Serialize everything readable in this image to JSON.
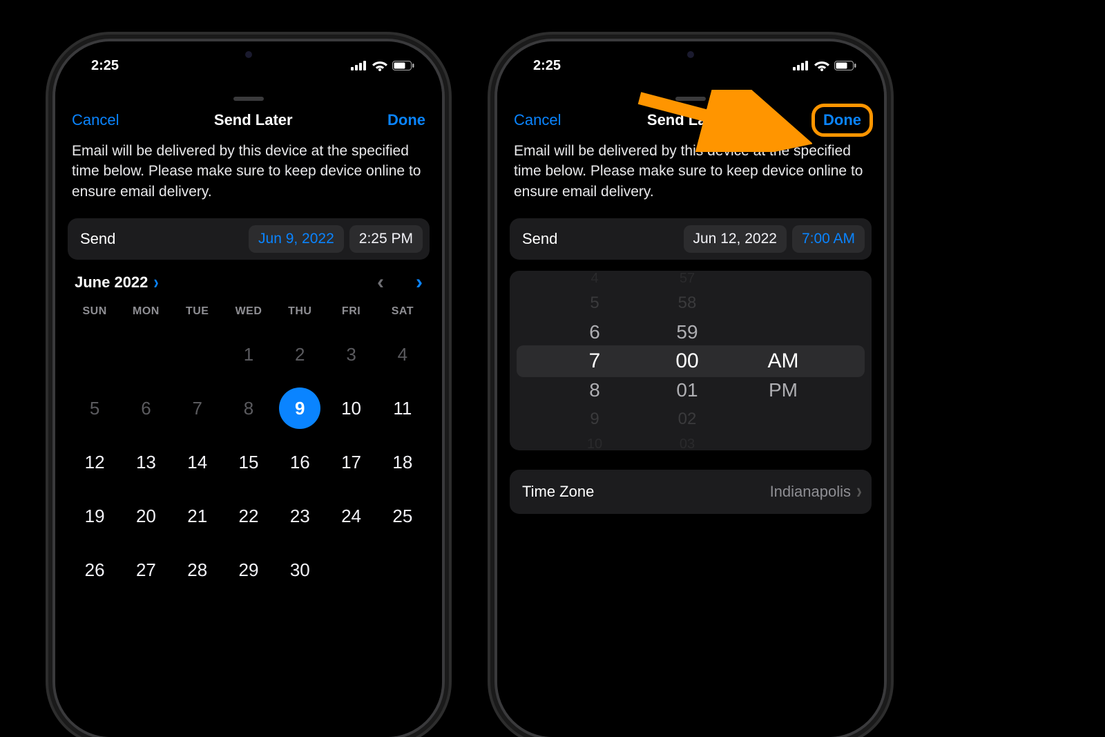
{
  "status": {
    "time": "2:25"
  },
  "nav": {
    "cancel": "Cancel",
    "title": "Send Later",
    "done": "Done"
  },
  "description": "Email will be delivered by this device at the specified time below. Please make sure to keep device online to ensure email delivery.",
  "left": {
    "send_label": "Send",
    "date_value": "Jun 9, 2022",
    "time_value": "2:25 PM",
    "calendar": {
      "month_label": "June 2022",
      "weekdays": [
        "SUN",
        "MON",
        "TUE",
        "WED",
        "THU",
        "FRI",
        "SAT"
      ],
      "leading_blanks": 3,
      "days_in_month": 30,
      "dim_days": [
        1,
        2,
        3,
        4,
        5,
        6,
        7,
        8
      ],
      "selected_day": 9
    }
  },
  "right": {
    "send_label": "Send",
    "date_value": "Jun 12, 2022",
    "time_value": "7:00 AM",
    "wheels": {
      "hours": [
        "4",
        "5",
        "6",
        "7",
        "8",
        "9",
        "10"
      ],
      "minutes": [
        "57",
        "58",
        "59",
        "00",
        "01",
        "02",
        "03"
      ],
      "ampm": [
        "AM",
        "PM"
      ]
    },
    "timezone": {
      "label": "Time Zone",
      "value": "Indianapolis"
    }
  },
  "colors": {
    "accent": "#0a84ff",
    "highlight": "#ff9500"
  }
}
